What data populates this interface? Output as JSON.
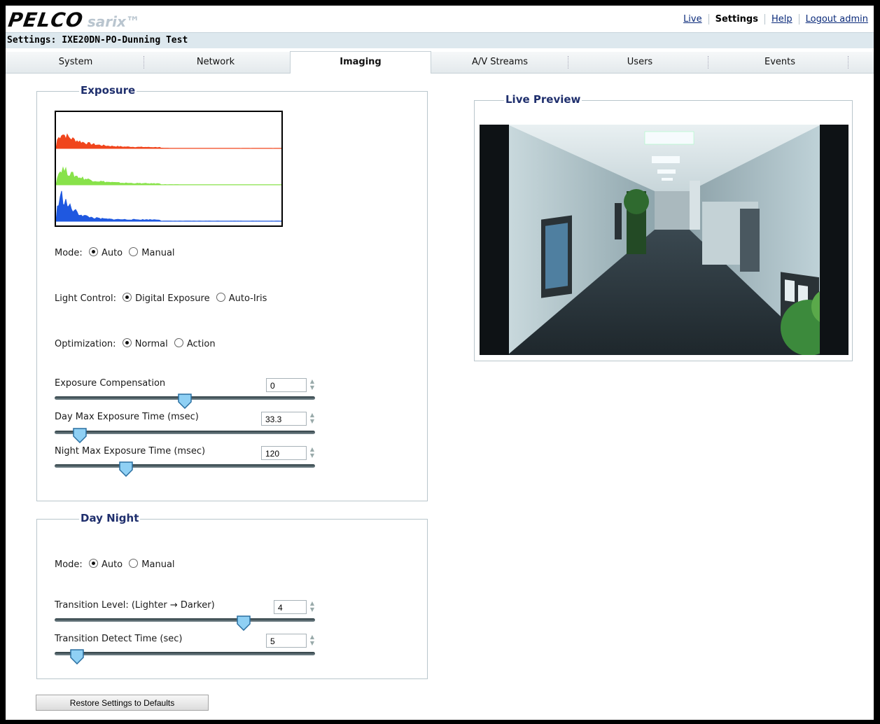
{
  "app": {
    "logo_text": "PELCO",
    "logo_sub": "sarix™"
  },
  "topnav": {
    "live": "Live",
    "settings": "Settings",
    "help": "Help",
    "logout": "Logout admin"
  },
  "title": "Settings: IXE20DN-PO-Dunning Test",
  "tabs": [
    "System",
    "Network",
    "Imaging",
    "A/V Streams",
    "Users",
    "Events"
  ],
  "active_tab": "Imaging",
  "exposure": {
    "legend": "Exposure",
    "histogram_colors": [
      "#f0451c",
      "#88e24a",
      "#1f58e0"
    ],
    "mode_label": "Mode:",
    "mode_options": [
      "Auto",
      "Manual"
    ],
    "mode_selected": "Auto",
    "light_label": "Light Control:",
    "light_options": [
      "Digital Exposure",
      "Auto-Iris"
    ],
    "light_selected": "Digital Exposure",
    "opt_label": "Optimization:",
    "opt_options": [
      "Normal",
      "Action"
    ],
    "opt_selected": "Normal",
    "comp_label": "Exposure Compensation",
    "comp_value": "0",
    "comp_fraction": 0.5,
    "daymax_label": "Day Max Exposure Time (msec)",
    "daymax_value": "33.3",
    "daymax_fraction": 0.07,
    "nightmax_label": "Night Max Exposure Time (msec)",
    "nightmax_value": "120",
    "nightmax_fraction": 0.26
  },
  "daynight": {
    "legend": "Day Night",
    "mode_label": "Mode:",
    "mode_options": [
      "Auto",
      "Manual"
    ],
    "mode_selected": "Auto",
    "level_label": "Transition Level: (Lighter → Darker)",
    "level_value": "4",
    "level_fraction": 0.74,
    "detect_label": "Transition Detect Time (sec)",
    "detect_value": "5",
    "detect_fraction": 0.06
  },
  "preview": {
    "legend": "Live Preview"
  },
  "restore_button": "Restore Settings to Defaults"
}
